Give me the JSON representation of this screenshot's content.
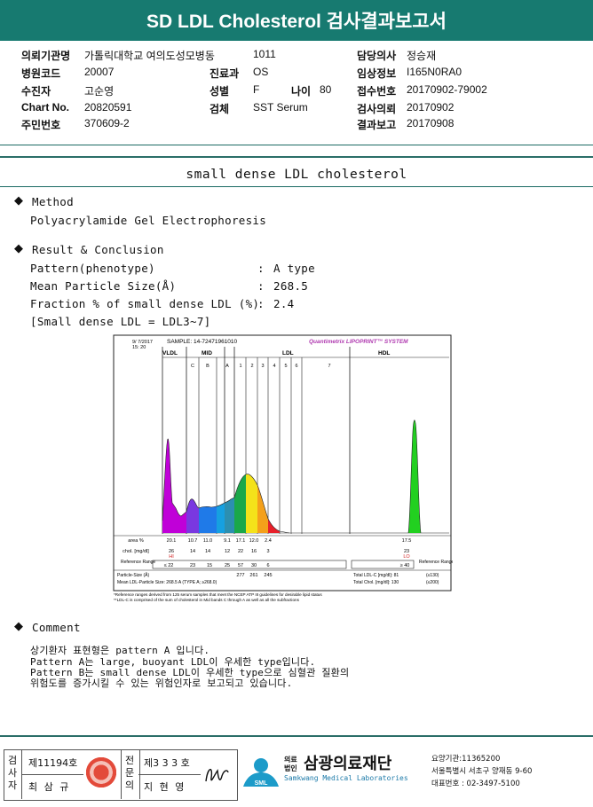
{
  "header": {
    "title": "SD LDL Cholesterol 검사결과보고서"
  },
  "info": {
    "col1": [
      {
        "label": "의뢰기관명",
        "value": "가톨릭대학교 여의도성모병동"
      },
      {
        "label": "병원코드",
        "value": "20007"
      },
      {
        "label": "수진자",
        "value": "고순영"
      },
      {
        "label": "Chart No.",
        "value": "20820591"
      },
      {
        "label": "주민번호",
        "value": "370609-2"
      }
    ],
    "col2": [
      {
        "label": "",
        "value": "1011"
      },
      {
        "label": "진료과",
        "value": "OS"
      },
      {
        "label": "성별",
        "value": "F"
      },
      {
        "label": "검체",
        "value": "SST Serum"
      }
    ],
    "age": {
      "label": "나이",
      "value": "80"
    },
    "col3": [
      {
        "label": "담당의사",
        "value": "정승재"
      },
      {
        "label": "임상정보",
        "value": "I165N0RA0"
      },
      {
        "label": "접수번호",
        "value": "20170902-79002"
      },
      {
        "label": "검사의뢰",
        "value": "20170902"
      },
      {
        "label": "결과보고",
        "value": "20170908"
      }
    ]
  },
  "report": {
    "title": "small dense LDL cholesterol",
    "method_heading": "Method",
    "method_text": "Polyacrylamide Gel Electrophoresis",
    "result_heading": "Result & Conclusion",
    "results": [
      {
        "label": "Pattern(phenotype)",
        "value": "A type"
      },
      {
        "label": "Mean Particle Size(Å)",
        "value": "268.5"
      },
      {
        "label": "Fraction % of small dense LDL (%)",
        "value": "2.4"
      }
    ],
    "note": "[Small dense LDL = LDL3~7]",
    "comment_heading": "Comment",
    "comment_lines": [
      "상기환자 표현형은 pattern A 입니다.",
      "Pattern A는 large, buoyant LDL이 우세한 type입니다.",
      "Pattern B는 small dense LDL이 우세한 type으로 심혈관 질환의",
      "위험도를 증가시킬 수 있는 위험인자로 보고되고 있습니다."
    ]
  },
  "chart": {
    "date": "9/ 7/2017",
    "time": "15: 20",
    "sample": "SAMPLE:  14-72471961010",
    "brand": "Quantimetrix LIPOPRINT™ SYSTEM",
    "regions": [
      "VLDL",
      "MID",
      "LDL",
      "HDL"
    ],
    "mid_bands": [
      "C",
      "B",
      "A"
    ],
    "ldl_bands": [
      "1",
      "2",
      "3",
      "4",
      "5",
      "6",
      "7"
    ],
    "rows": {
      "area_label": "area %",
      "area": [
        "20.1",
        "10.7",
        "11.0",
        "9.1",
        "17.1",
        "12.0",
        "2.4",
        "17.5"
      ],
      "chol_label": "chol. [mg/dl]",
      "chol": [
        "26",
        "14",
        "14",
        "12",
        "22",
        "16",
        "3",
        "23"
      ],
      "chol_flag_hi": "HI",
      "chol_flag_lo": "LO",
      "ref_label": "Reference Range",
      "ref": [
        "≤ 22",
        "23",
        "15",
        "25",
        "57",
        "30",
        "6",
        "≥ 40"
      ]
    },
    "particle_label": "Particle-Size (Å)",
    "particle_values": [
      "277",
      "261",
      "245"
    ],
    "mean_label": "Mean LDL-Particle Size:  268.5 A  (TYPE A;  ≥268.0)",
    "total_ldl": "Total LDL-C [mg/dl]:  81",
    "total_ldl_ref": "(≤130)",
    "total_chol": "Total Chol. [mg/dl]:  130",
    "total_chol_ref": "(≤200)",
    "footnote1": "*Reference ranges derived from 125 serum samples that meet the NCEP ATP III guidelines for desirable lipid status",
    "footnote2": "**LDL-C is comprised of the sum of cholesterol in Mid bands C through A as well as all the subfractions"
  },
  "footer": {
    "tester_label": "검사자",
    "tester_no": "제11194호",
    "tester_name": "최 삼 규",
    "spec_label": "전문의",
    "spec_no": "제3 3 3 호",
    "spec_name": "지 현 영",
    "org_small1": "의료",
    "org_small2": "법인",
    "org_name": "삼광의료재단",
    "org_en": "Samkwang Medical Laboratories",
    "sml": "SML",
    "contact1": "요양기관:11365200",
    "contact2": "서울특별시 서초구 양재동 9-60",
    "contact3": "대표번호 : 02-3497-5100"
  }
}
